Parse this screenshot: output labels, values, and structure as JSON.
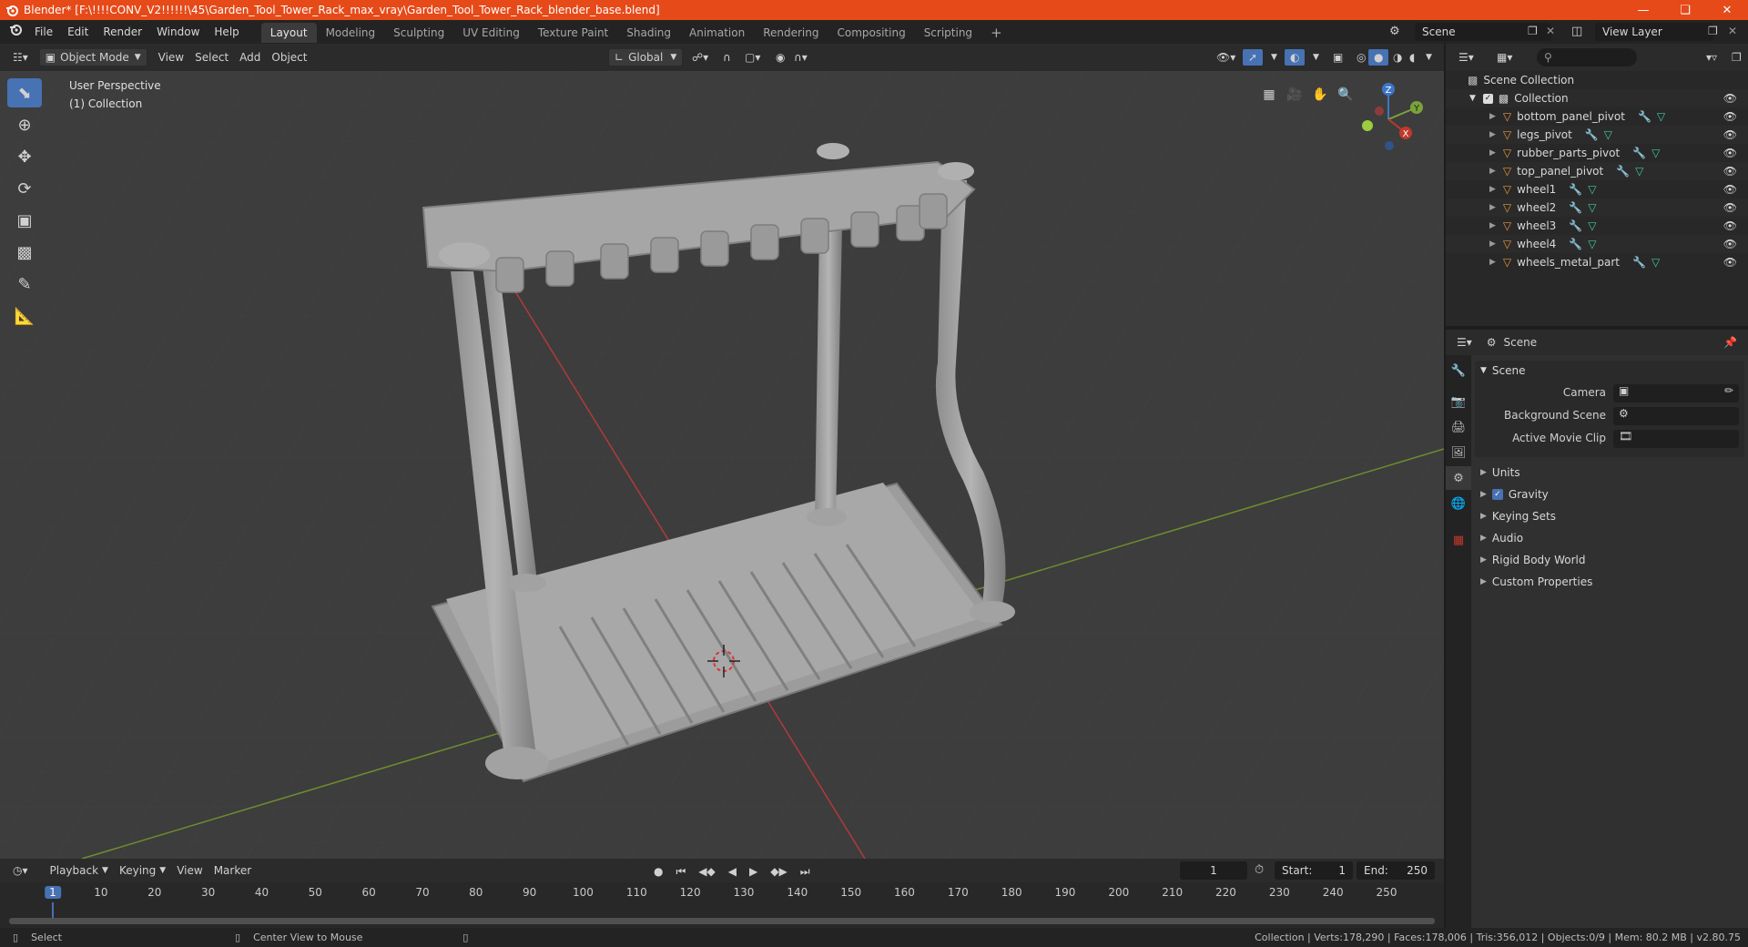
{
  "window": {
    "title": "Blender* [F:\\!!!!CONV_V2!!!!!!\\45\\Garden_Tool_Tower_Rack_max_vray\\Garden_Tool_Tower_Rack_blender_base.blend]"
  },
  "menu": [
    "File",
    "Edit",
    "Render",
    "Window",
    "Help"
  ],
  "workspaces": [
    "Layout",
    "Modeling",
    "Sculpting",
    "UV Editing",
    "Texture Paint",
    "Shading",
    "Animation",
    "Rendering",
    "Compositing",
    "Scripting"
  ],
  "scene_selector": {
    "label": "Scene"
  },
  "view_layer_selector": {
    "label": "View Layer"
  },
  "viewport_header": {
    "mode": "Object Mode",
    "view": "View",
    "select": "Select",
    "add": "Add",
    "object": "Object",
    "transform_orientation": "Global"
  },
  "viewport": {
    "perspective": "User Perspective",
    "collection": "(1) Collection"
  },
  "outliner": {
    "root": "Scene Collection",
    "collection": "Collection",
    "objects": [
      "bottom_panel_pivot",
      "legs_pivot",
      "rubber_parts_pivot",
      "top_panel_pivot",
      "wheel1",
      "wheel2",
      "wheel3",
      "wheel4",
      "wheels_metal_part"
    ]
  },
  "properties": {
    "header": "Scene",
    "section_title": "Scene",
    "fields": [
      {
        "label": "Camera"
      },
      {
        "label": "Background Scene"
      },
      {
        "label": "Active Movie Clip"
      }
    ],
    "subsections": [
      {
        "label": "Units",
        "checkbox": false
      },
      {
        "label": "Gravity",
        "checkbox": true
      },
      {
        "label": "Keying Sets",
        "checkbox": false
      },
      {
        "label": "Audio",
        "checkbox": false
      },
      {
        "label": "Rigid Body World",
        "checkbox": false
      },
      {
        "label": "Custom Properties",
        "checkbox": false
      }
    ]
  },
  "timeline": {
    "playback": "Playback",
    "keying": "Keying",
    "view": "View",
    "marker": "Marker",
    "current_frame": "1",
    "start_label": "Start:",
    "start": "1",
    "end_label": "End:",
    "end": "250",
    "ticks": [
      "1",
      "10",
      "20",
      "30",
      "40",
      "50",
      "60",
      "70",
      "80",
      "90",
      "100",
      "110",
      "120",
      "130",
      "140",
      "150",
      "160",
      "170",
      "180",
      "190",
      "200",
      "210",
      "220",
      "230",
      "240",
      "250"
    ]
  },
  "statusbar": {
    "select": "Select",
    "center_view": "Center View to Mouse",
    "stats": "Collection | Verts:178,290 | Faces:178,006 | Tris:356,012 | Objects:0/9 | Mem: 80.2 MB | v2.80.75"
  },
  "colors": {
    "titlebar": "#e64a19",
    "accent": "#4772b3",
    "x_axis": "#c0392b",
    "y_axis": "#7aa33a",
    "object_icon": "#e9973b",
    "modifier_icon": "#6aa9e0",
    "mesh_icon": "#41c9a5"
  }
}
